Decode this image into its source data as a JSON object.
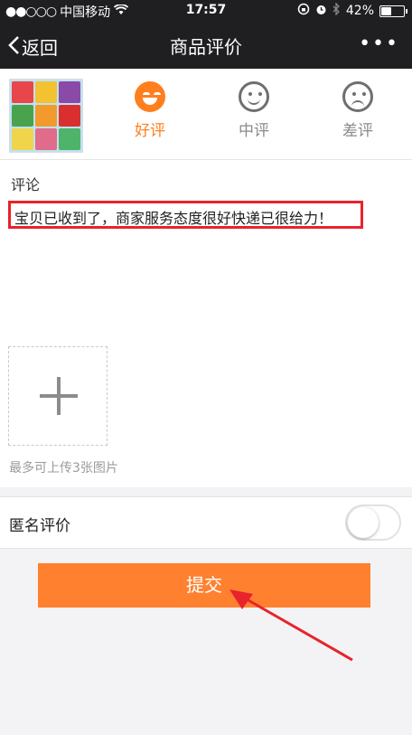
{
  "status_bar": {
    "signal": "●●○○○",
    "carrier": "中国移动",
    "time": "17:57",
    "battery": "42%",
    "battery_level": 0.42
  },
  "nav": {
    "back_label": "返回",
    "title": "商品评价",
    "more": "•••"
  },
  "rating": {
    "options": [
      {
        "label": "好评",
        "selected": true
      },
      {
        "label": "中评",
        "selected": false
      },
      {
        "label": "差评",
        "selected": false
      }
    ],
    "accent_color": "#ff7f1e"
  },
  "comment": {
    "label": "评论",
    "text": "宝贝已收到了，商家服务态度很好快递已很给力！",
    "highlight_color": "#e8232b"
  },
  "upload": {
    "hint": "最多可上传3张图片"
  },
  "anonymous": {
    "label": "匿名评价",
    "enabled": false
  },
  "submit": {
    "label": "提交",
    "color": "#ff8130"
  }
}
